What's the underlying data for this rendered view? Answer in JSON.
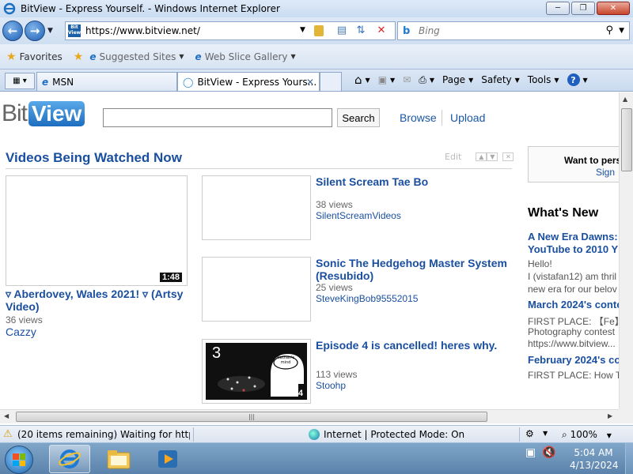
{
  "window": {
    "title": "BitView - Express Yourself. - Windows Internet Explorer",
    "minimize": "─",
    "restore": "❐",
    "close": "✕"
  },
  "address_bar": {
    "url": "https://www.bitview.net/",
    "search_placeholder": "Bing"
  },
  "favorites_bar": {
    "favorites": "Favorites",
    "suggested_sites": "Suggested Sites",
    "web_slice_gallery": "Web Slice Gallery"
  },
  "tabs": [
    {
      "label": "MSN"
    },
    {
      "label": "BitView - Express Yours..."
    }
  ],
  "command_bar": {
    "page": "Page",
    "safety": "Safety",
    "tools": "Tools",
    "help": "?"
  },
  "site": {
    "logo_bit": "Bit",
    "logo_view": "View",
    "search_button": "Search",
    "nav": [
      "Browse",
      "Upload"
    ]
  },
  "section": {
    "title": "Videos Being Watched Now",
    "edit": "Edit"
  },
  "featured_video": {
    "duration": "1:48",
    "title": "▿ Aberdovey, Wales 2021! ▿ (Artsy Video)",
    "views": "36 views",
    "user": "Cazzy"
  },
  "videos": [
    {
      "title": "Silent Scream Tae Bo",
      "views": "38 views",
      "user": "SilentScreamVideos"
    },
    {
      "title": "Sonic The Hedgehog Master System (Resubido)",
      "views": "25 views",
      "user": "SteveKingBob95552015"
    },
    {
      "title": "Episode 4 is cancelled! heres why.",
      "views": "113 views",
      "user": "Stoohp",
      "duration": "7:14",
      "thumb_number": "3",
      "thumb_caption": "Nathan's mind"
    }
  ],
  "right_panel": {
    "box_title": "Want to pers",
    "box_link": "Sign",
    "whats_new": "What's New",
    "items": [
      {
        "heading": "A New Era Dawns:",
        "heading2": "YouTube to 2010 Y",
        "lines": [
          "Hello!",
          "I (vistafan12) am thril",
          "new era for our belov"
        ]
      },
      {
        "heading": "March 2024's conte",
        "lines": [
          "FIRST PLACE: 【Fe】",
          "Photography contest",
          "https://www.bitview..."
        ]
      },
      {
        "heading": "February 2024's co",
        "lines": [
          "FIRST PLACE: How T"
        ]
      }
    ]
  },
  "status_bar": {
    "text": "(20 items remaining) Waiting for https://v",
    "zone": "Internet | Protected Mode: On",
    "zoom": "100%"
  },
  "taskbar": {
    "time": "5:04 AM",
    "date": "4/13/2024"
  }
}
